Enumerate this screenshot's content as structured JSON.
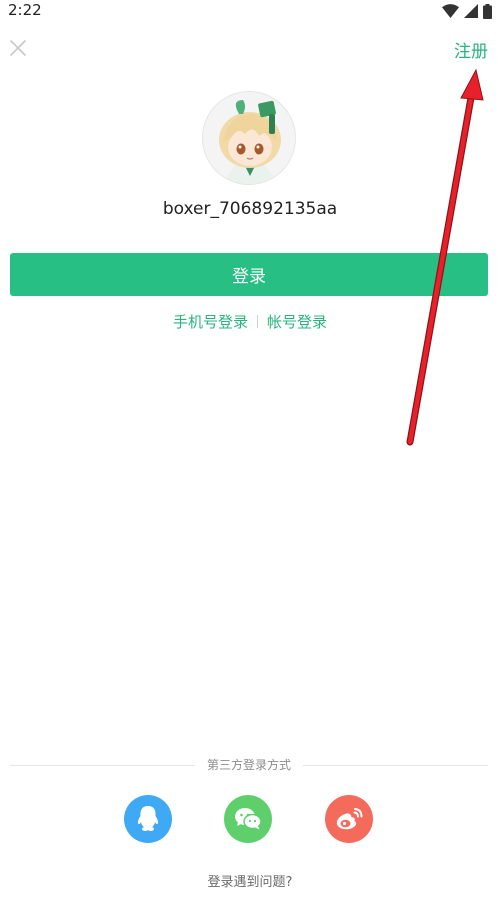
{
  "status_bar": {
    "time": "2:22"
  },
  "header": {
    "close_icon": "close-icon",
    "register_label": "注册"
  },
  "profile": {
    "username": "boxer_706892135aa"
  },
  "login": {
    "button_label": "登录",
    "phone_login_label": "手机号登录",
    "account_login_label": "帐号登录"
  },
  "third_party": {
    "title": "第三方登录方式",
    "providers": [
      {
        "name": "qq",
        "icon": "qq-icon",
        "color": "#3fa9f5"
      },
      {
        "name": "wechat",
        "icon": "wechat-icon",
        "color": "#5fcf6b"
      },
      {
        "name": "weibo",
        "icon": "weibo-icon",
        "color": "#f46a5b"
      }
    ]
  },
  "footer": {
    "help_label": "登录遇到问题?"
  },
  "colors": {
    "accent": "#27bf84",
    "annotation": "#e8202a"
  }
}
